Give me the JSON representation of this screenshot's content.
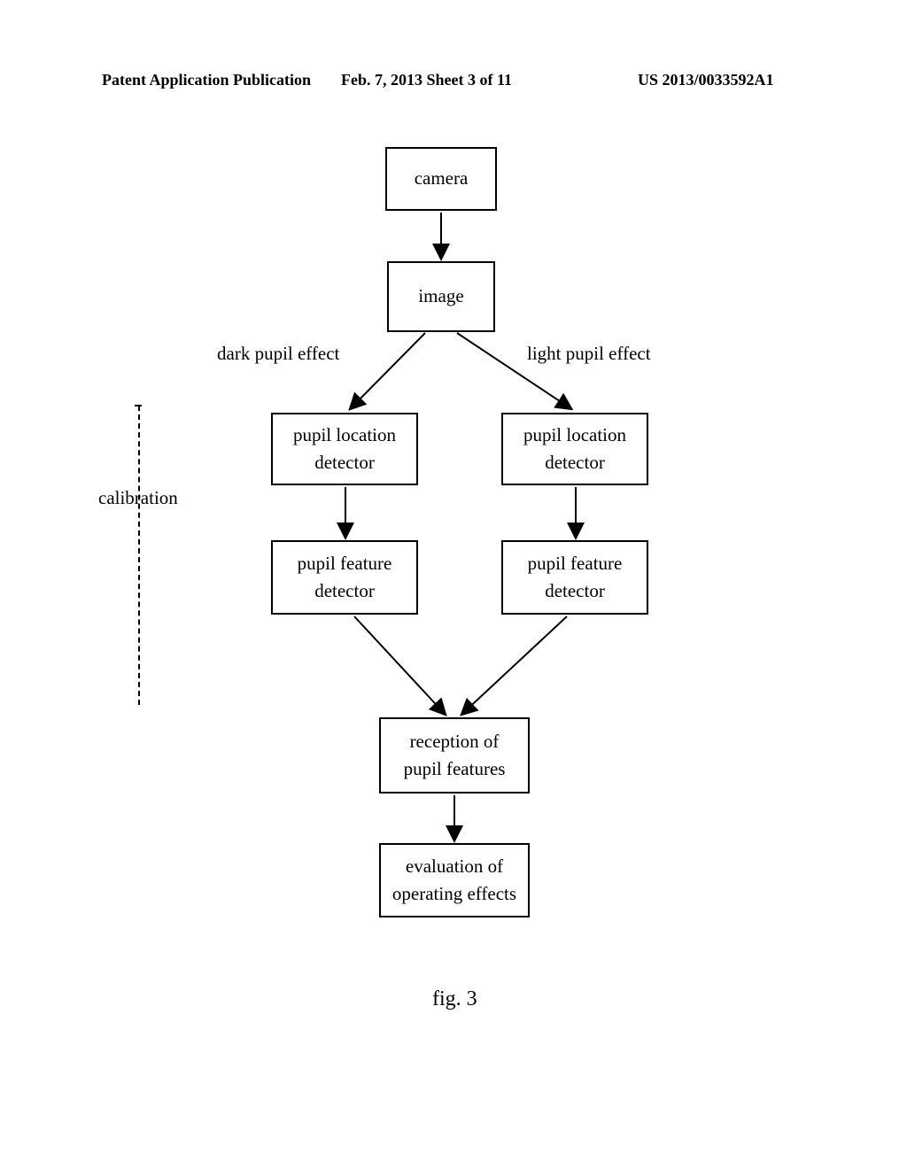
{
  "header": {
    "left": "Patent Application Publication",
    "center": "Feb. 7, 2013   Sheet 3 of 11",
    "right": "US 2013/0033592A1"
  },
  "diagram": {
    "camera": "camera",
    "image": "image",
    "dark_label": "dark pupil effect",
    "light_label": "light pupil effect",
    "calibration": "calibration",
    "loc_detector_left_l1": "pupil location",
    "loc_detector_left_l2": "detector",
    "loc_detector_right_l1": "pupil location",
    "loc_detector_right_l2": "detector",
    "feat_detector_left_l1": "pupil feature",
    "feat_detector_left_l2": "detector",
    "feat_detector_right_l1": "pupil feature",
    "feat_detector_right_l2": "detector",
    "reception_l1": "reception of",
    "reception_l2": "pupil features",
    "evaluation_l1": "evaluation of",
    "evaluation_l2": "operating effects",
    "figure_label": "fig. 3"
  }
}
